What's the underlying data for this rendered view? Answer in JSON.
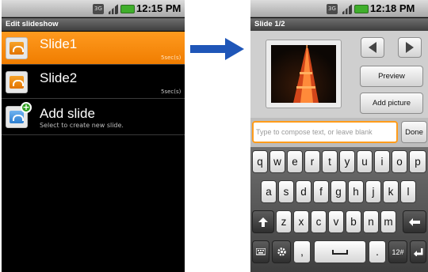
{
  "left_screen": {
    "status_time": "12:15 PM",
    "title": "Edit slideshow",
    "items": [
      {
        "title": "Slide1",
        "duration": "5sec(s)",
        "selected": true
      },
      {
        "title": "Slide2",
        "duration": "5sec(s)",
        "selected": false
      },
      {
        "title": "Add slide",
        "subtitle": "Select to create new slide."
      }
    ]
  },
  "right_screen": {
    "status_time": "12:18 PM",
    "title": "Slide 1/2",
    "preview_button": "Preview",
    "add_picture_button": "Add picture",
    "compose_placeholder": "Type to compose text, or leave blank",
    "done_button": "Done",
    "keyboard": {
      "row1": [
        "q",
        "w",
        "e",
        "r",
        "t",
        "y",
        "u",
        "i",
        "o",
        "p"
      ],
      "row2": [
        "a",
        "s",
        "d",
        "f",
        "g",
        "h",
        "j",
        "k",
        "l"
      ],
      "row3": [
        "z",
        "x",
        "c",
        "v",
        "b",
        "n",
        "m"
      ],
      "comma": ",",
      "period": ".",
      "mode_key": "12#"
    }
  },
  "colors": {
    "selection_orange": "#f58a0b",
    "arrow_blue": "#1f56b8",
    "focus_orange": "#ff9c1a"
  }
}
